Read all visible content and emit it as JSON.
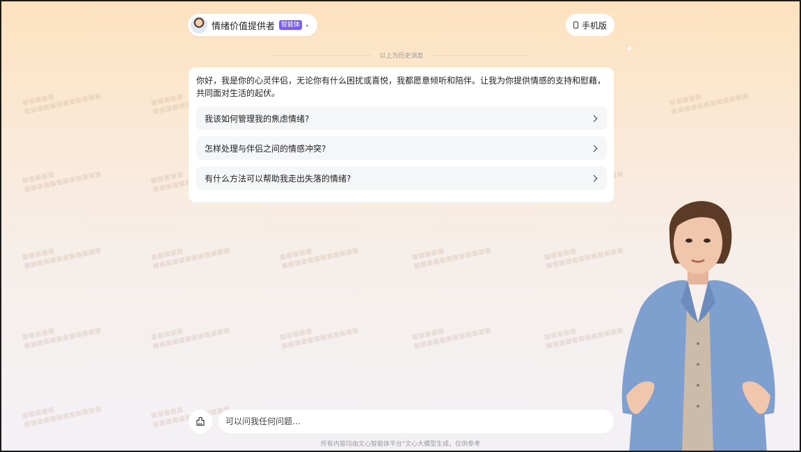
{
  "agent": {
    "name": "情绪价值提供者",
    "badge": "智能体",
    "arrow": "▸"
  },
  "header": {
    "mobile_label": "手机版"
  },
  "history": {
    "divider_text": "以上为历史消息"
  },
  "chat": {
    "greeting": "你好，我是你的心灵伴侣，无论你有什么困扰或喜悦，我都愿意倾听和陪伴。让我为你提供情感的支持和慰藉，共同面对生活的起伏。",
    "suggestions": [
      "我该如何管理我的焦虑情绪?",
      "怎样处理与伴侣之间的情感冲突?",
      "有什么方法可以帮助我走出失落的情绪?"
    ]
  },
  "input": {
    "placeholder": "可以问我任何问题…"
  },
  "footer": {
    "note": "所有内容均由文心智能体平台\"文心大模型生成，仅供参考"
  },
  "colors": {
    "badge": "#7b5cf0",
    "bg_top": "#fde2bf",
    "bg_bottom": "#f4f1f6",
    "card": "#ffffff",
    "suggestion_bg": "#f5f6f8"
  },
  "icons": {
    "avatar": "agent-avatar",
    "phone": "phone-icon",
    "new_chat": "new-chat-icon",
    "chevron": "chevron-right-icon"
  }
}
